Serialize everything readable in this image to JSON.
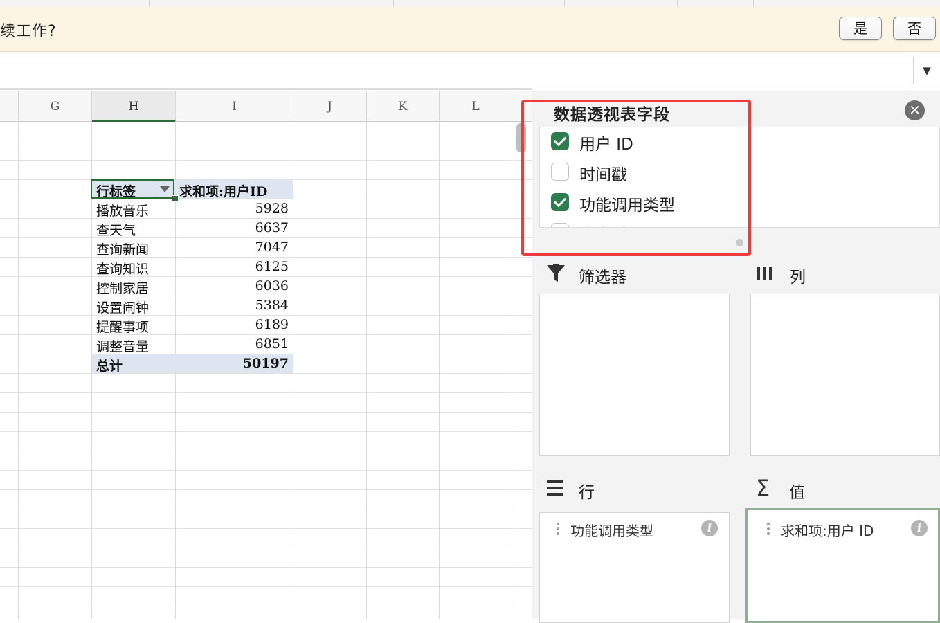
{
  "notification": {
    "text": "续工作?",
    "yes_label": "是",
    "no_label": "否"
  },
  "formula_bar": {
    "dropdown_icon": "triangle-down-icon",
    "dropdown_glyph": "▼"
  },
  "columns": [
    "G",
    "H",
    "I",
    "J",
    "K",
    "L"
  ],
  "active_column": "H",
  "pivot": {
    "row_label_header": "行标签",
    "value_header": "求和项:用户ID",
    "rows": [
      {
        "label": "播放音乐",
        "value": "5928"
      },
      {
        "label": "查天气",
        "value": "6637"
      },
      {
        "label": "查询新闻",
        "value": "7047"
      },
      {
        "label": "查询知识",
        "value": "6125"
      },
      {
        "label": "控制家居",
        "value": "6036"
      },
      {
        "label": "设置闹钟",
        "value": "5384"
      },
      {
        "label": "提醒事项",
        "value": "6189"
      },
      {
        "label": "调整音量",
        "value": "6851"
      }
    ],
    "total_label": "总计",
    "total_value": "50197"
  },
  "panel": {
    "title": "数据透视表字段",
    "close_glyph": "✕",
    "fields": [
      {
        "label": "用户 ID",
        "checked": true
      },
      {
        "label": "时间戳",
        "checked": false
      },
      {
        "label": "功能调用类型",
        "checked": true
      },
      {
        "label": "响应时间",
        "checked": false
      }
    ],
    "areas": {
      "filter": {
        "label": "筛选器",
        "icon": "funnel-icon"
      },
      "columns": {
        "label": "列",
        "icon": "columns-icon"
      },
      "rows": {
        "label": "行",
        "icon": "rows-icon",
        "items": [
          "功能调用类型"
        ]
      },
      "values": {
        "label": "值",
        "icon": "sigma-icon",
        "glyph": "Σ",
        "items": [
          "求和项:用户 ID"
        ]
      }
    },
    "info_glyph": "i",
    "highlight_color": "#ee3b3b",
    "accent_color": "#2e7d4f"
  }
}
